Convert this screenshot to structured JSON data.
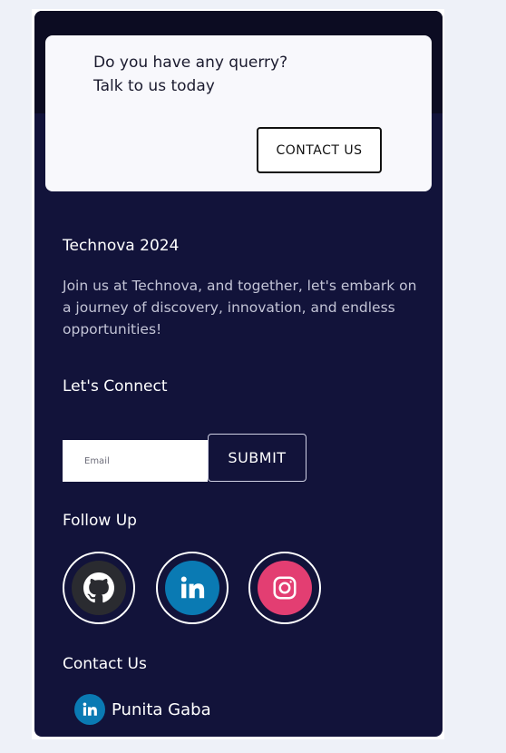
{
  "query_card": {
    "line1": "Do you have any querry?",
    "line2": "Talk to us today",
    "button_label": "CONTACT US"
  },
  "brand": {
    "title": "Technova 2024",
    "description": "Join us at Technova, and together, let's embark on a journey of discovery, innovation, and endless opportunities!"
  },
  "connect": {
    "heading": "Let's Connect",
    "email_placeholder": "Email",
    "email_value": "",
    "submit_label": "SUBMIT"
  },
  "follow": {
    "heading": "Follow Up",
    "icons": [
      "github-icon",
      "linkedin-icon",
      "instagram-icon"
    ]
  },
  "contact": {
    "heading": "Contact Us",
    "people": [
      {
        "name": "Punita Gaba",
        "icon": "linkedin-icon"
      }
    ]
  },
  "colors": {
    "page_bg": "#eef1f8",
    "footer_bg": "#12133a",
    "footer_top": "#0c0c22",
    "card_bg": "#f8f8fc",
    "github": "#2a2b30",
    "linkedin": "#0a7ab3",
    "instagram": "#e33e72"
  }
}
